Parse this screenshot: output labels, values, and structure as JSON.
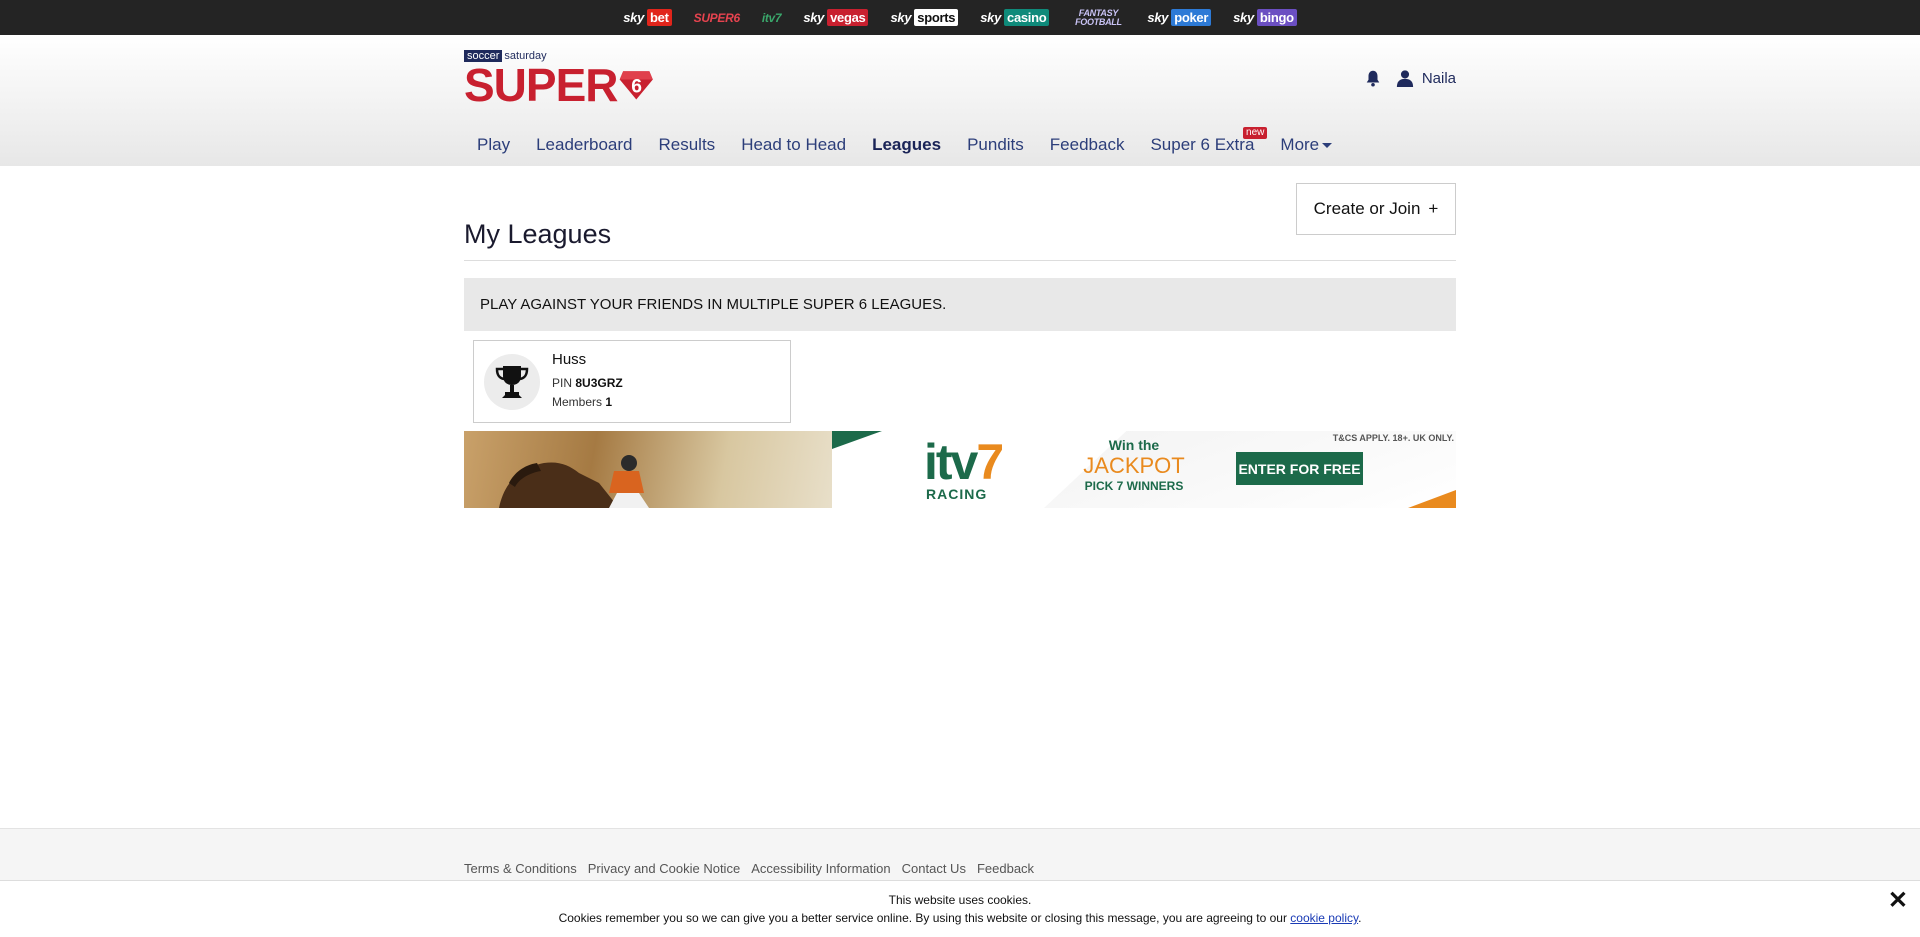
{
  "brandbar": {
    "items": [
      {
        "sky": "sky",
        "label": "bet",
        "color": "#e1251b"
      },
      {
        "sky": "",
        "label": "SUPER6",
        "color": "#c8202f"
      },
      {
        "sky": "",
        "label": "itv7",
        "color": "#1c6a4a"
      },
      {
        "sky": "sky",
        "label": "vegas",
        "color": "#c8202f"
      },
      {
        "sky": "sky",
        "label": "sports",
        "color": "#ffffff"
      },
      {
        "sky": "sky",
        "label": "casino",
        "color": "#0f8a7a"
      },
      {
        "sky": "",
        "label": "FANTASY FOOTBALL",
        "color": "#5a4fc2"
      },
      {
        "sky": "sky",
        "label": "poker",
        "color": "#2d7ad6"
      },
      {
        "sky": "sky",
        "label": "bingo",
        "color": "#6b4fc2"
      }
    ]
  },
  "header": {
    "logo_top_left": "soccer",
    "logo_top_right": "saturday",
    "logo_main": "SUPER",
    "logo_number": "6",
    "username": "Naila"
  },
  "nav": {
    "items": [
      {
        "label": "Play"
      },
      {
        "label": "Leaderboard"
      },
      {
        "label": "Results"
      },
      {
        "label": "Head to Head"
      },
      {
        "label": "Leagues"
      },
      {
        "label": "Pundits"
      },
      {
        "label": "Feedback"
      },
      {
        "label": "Super 6 Extra",
        "badge": "new"
      },
      {
        "label": "More"
      }
    ],
    "active": "Leagues"
  },
  "main": {
    "title": "My Leagues",
    "create_label": "Create or Join",
    "create_symbol": "+",
    "banner": "PLAY AGAINST YOUR FRIENDS IN MULTIPLE SUPER 6 LEAGUES."
  },
  "leagues": [
    {
      "name": "Huss",
      "pin_label": "PIN",
      "pin": "8U3GRZ",
      "members_label": "Members",
      "members": "1"
    }
  ],
  "ad": {
    "brand": "itv",
    "brand_number": "7",
    "brand_sub": "RACING",
    "win_line": "Win the",
    "jackpot": "JACKPOT",
    "pick": "PICK 7 WINNERS",
    "cta": "ENTER FOR FREE",
    "terms": "T&CS APPLY. 18+. UK ONLY."
  },
  "footer": {
    "links": [
      "Terms & Conditions",
      "Privacy and Cookie Notice",
      "Accessibility Information",
      "Contact Us",
      "Feedback"
    ]
  },
  "cookie": {
    "title": "This website uses cookies.",
    "body": "Cookies remember you so we can give you a better service online. By using this website or closing this message, you are agreeing to our",
    "link": "cookie policy",
    "end": ".",
    "close_icon": "close-icon"
  },
  "colors": {
    "brand_red": "#c8202f",
    "navy": "#1f2a5c",
    "itv_green": "#1c6a4a",
    "itv_orange": "#e98a1e"
  }
}
